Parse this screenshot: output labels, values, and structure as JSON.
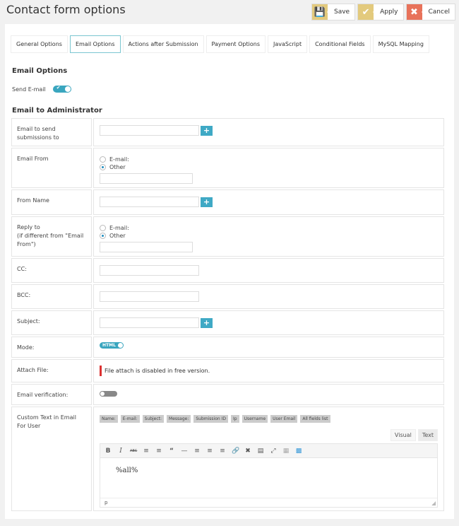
{
  "header": {
    "title": "Contact form options"
  },
  "toolbar": {
    "save": "Save",
    "apply": "Apply",
    "cancel": "Cancel"
  },
  "tabs": [
    {
      "label": "General Options"
    },
    {
      "label": "Email Options",
      "active": true
    },
    {
      "label": "Actions after Submission"
    },
    {
      "label": "Payment Options"
    },
    {
      "label": "JavaScript"
    },
    {
      "label": "Conditional Fields"
    },
    {
      "label": "MySQL Mapping"
    }
  ],
  "email_options": {
    "heading": "Email Options",
    "send_email_label": "Send E-mail",
    "send_email_on": true
  },
  "admin": {
    "heading": "Email to Administrator",
    "rows": {
      "submissions_to": "Email to send submissions to",
      "email_from": "Email From",
      "from_name": "From Name",
      "reply_to": "Reply to\n(if different from \"Email From\")",
      "cc": "CC:",
      "bcc": "BCC:",
      "subject": "Subject:",
      "mode": "Mode:",
      "attach_file": "Attach File:",
      "email_verification": "Email verification:",
      "custom_text": "Custom Text in Email For User"
    },
    "radio_email": "E-mail:",
    "radio_other": "Other",
    "mode_value": "HTML",
    "attach_notice": "File attach is disabled in free version.",
    "email_verification_on": false,
    "tags": [
      "Name:",
      "E-mail:",
      "Subject:",
      "Message:",
      "Submission ID",
      "Ip",
      "Username",
      "User Email",
      "All fields list"
    ],
    "editor": {
      "visual": "Visual",
      "text": "Text",
      "content": "%all%",
      "status": "p"
    }
  }
}
